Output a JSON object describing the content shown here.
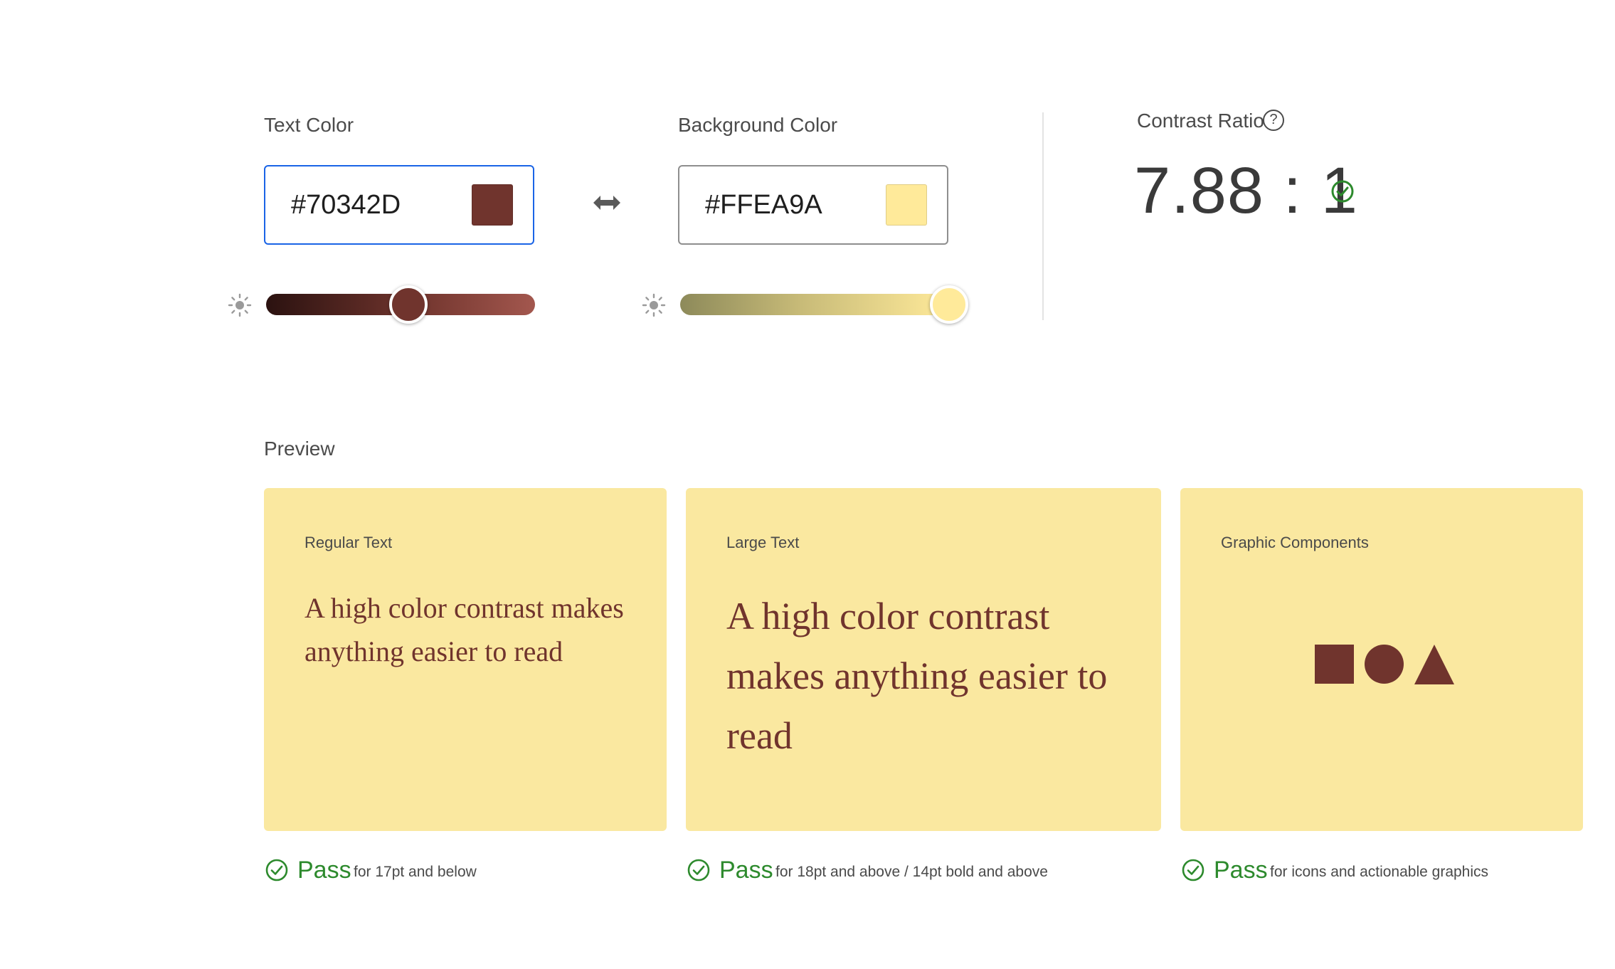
{
  "colors": {
    "text": "#70342D",
    "background": "#FFEA9A",
    "card_bg": "#FAE8A0",
    "pass_green": "#2D8A2D",
    "focus_blue": "#1A64E6"
  },
  "text_color": {
    "label": "Text Color",
    "value": "#70342D",
    "brightness_level": 0.53
  },
  "background_color": {
    "label": "Background Color",
    "value": "#FFEA9A",
    "brightness_level": 1.0
  },
  "swap_icon": "swap-horizontal-icon",
  "contrast": {
    "label": "Contrast Ratio",
    "help_glyph": "?",
    "value": "7.88 : 1"
  },
  "preview": {
    "title": "Preview",
    "cards": [
      {
        "title": "Regular Text",
        "sample": "A high color contrast makes anything easier to read",
        "result": "Pass",
        "note": "for 17pt and below"
      },
      {
        "title": "Large Text",
        "sample": "A high color contrast makes anything easier to read",
        "result": "Pass",
        "note": "for 18pt and above / 14pt bold and above"
      },
      {
        "title": "Graphic Components",
        "shapes": [
          "square",
          "circle",
          "triangle"
        ],
        "result": "Pass",
        "note": "for icons and actionable graphics"
      }
    ]
  }
}
